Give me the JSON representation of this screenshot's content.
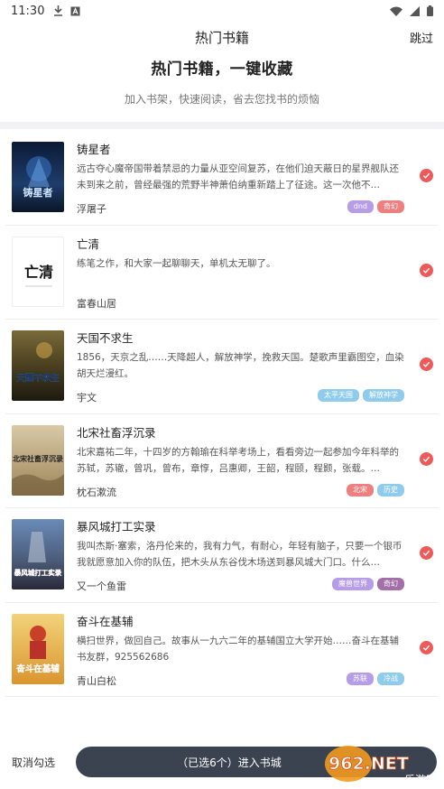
{
  "status_bar": {
    "time": "11:30"
  },
  "top_bar": {
    "title": "热门书籍",
    "skip_label": "跳过"
  },
  "hero": {
    "headline": "热门书籍，一键收藏",
    "subtitle": "加入书架，快速阅读，省去您找书的烦恼"
  },
  "books": [
    {
      "title": "铸星者",
      "desc": "远古夺心魔帝国带着禁忌的力量从亚空间复苏，在他们迫天蔽日的星界舰队还未到来之前，曾经最强的荒野半神萧伯纳重新踏上了征途。这一次他不…",
      "author": "浮屠子",
      "cover_text": "铸星者",
      "tags": [
        {
          "label": "dnd",
          "color": "#b79ce6"
        },
        {
          "label": "奇幻",
          "color": "#ee7f7f"
        }
      ]
    },
    {
      "title": "亡清",
      "desc": "练笔之作，和大家一起聊聊天，单机太无聊了。",
      "author": "富春山居",
      "cover_text": "亡清",
      "tags": []
    },
    {
      "title": "天国不求生",
      "desc": "1856，天京之乱……天降超人，解放神学，挽救天国。楚歌声里霸图空，血染胡天烂漫红。",
      "author": "宇文",
      "cover_text": "天国不求生",
      "tags": [
        {
          "label": "太平天国",
          "color": "#8fcbeb"
        },
        {
          "label": "解放神学",
          "color": "#8fcbeb"
        }
      ]
    },
    {
      "title": "北宋社畜浮沉录",
      "desc": "北宋嘉祐二年，十四岁的方翰瑜在科举考场上，看看旁边一起参加今年科举的苏轼，苏辙，曾巩，曾布，章惇，吕惠卿，王韶，程颐，程颢，张载。…",
      "author": "枕石漱流",
      "cover_text": "北宋社畜浮沉录",
      "tags": [
        {
          "label": "北宋",
          "color": "#ee7f7f"
        },
        {
          "label": "历史",
          "color": "#8fcbeb"
        }
      ]
    },
    {
      "title": "暴风城打工实录",
      "desc": "我叫杰斯·塞索，洛丹伦来的，我有力气，有耐心，年轻有脑子，只要一个银币我就愿意加入你的队伍，把木头从东谷伐木场送到暴风城大门口。什么…",
      "author": "又一个鱼雷",
      "cover_text": "暴风城打工实录",
      "tags": [
        {
          "label": "魔兽世界",
          "color": "#b79ce6"
        },
        {
          "label": "奇幻",
          "color": "#a36fa8"
        }
      ]
    },
    {
      "title": "奋斗在基辅",
      "desc": "横扫世界，做回自己。故事从一九六二年的基辅国立大学开始……奋斗在基辅书友群，925562686",
      "author": "青山白松",
      "cover_text": "奋斗在基辅",
      "tags": [
        {
          "label": "苏联",
          "color": "#b79ce6"
        },
        {
          "label": "冷战",
          "color": "#8fcbeb"
        }
      ]
    }
  ],
  "bottom_bar": {
    "cancel_label": "取消勾选",
    "enter_label": "（已选6个）进入书城"
  },
  "watermark": {
    "text": "962.NET",
    "sub": "乐游网"
  },
  "colors": {
    "check": "#ee5a5a",
    "button": "#3b4250"
  }
}
